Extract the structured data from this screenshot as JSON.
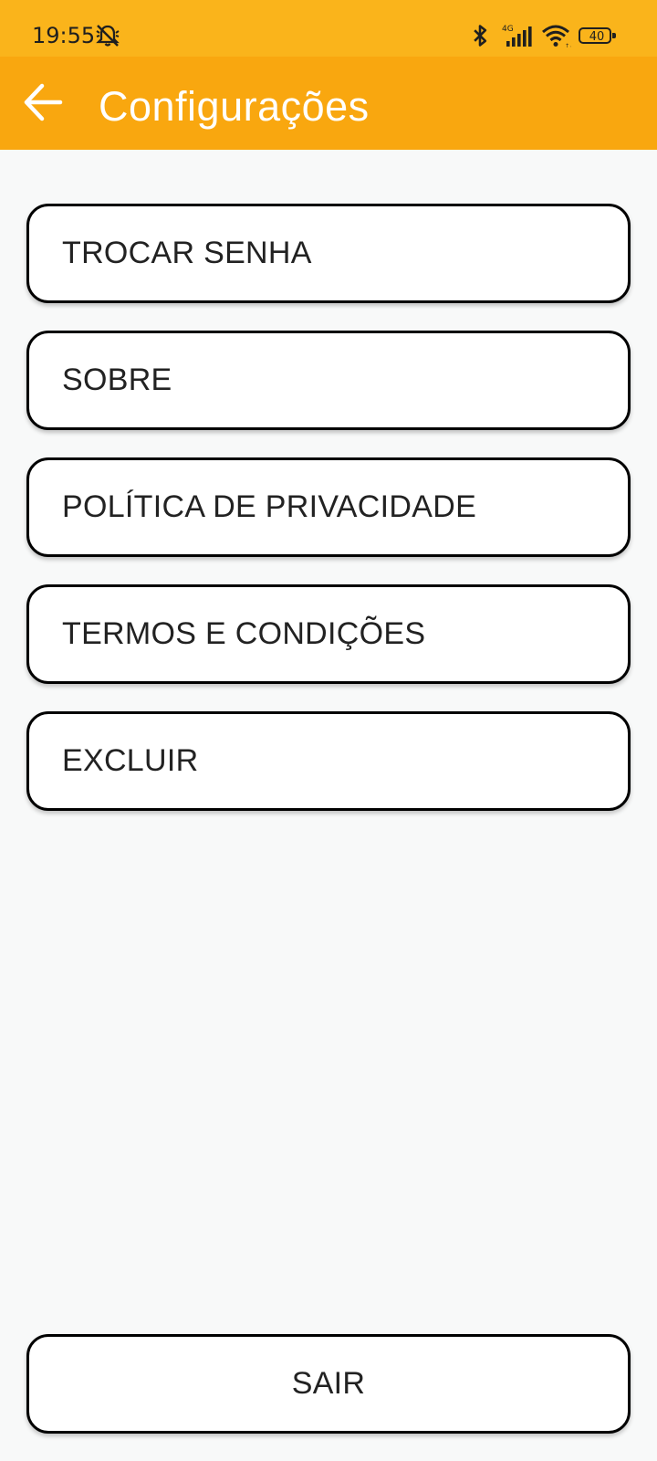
{
  "status_bar": {
    "time": "19:55",
    "left_icon": "notifications-off-icon",
    "network_label": "4G",
    "battery_level": "40",
    "icons": [
      "bluetooth-icon",
      "signal-icon",
      "wifi-icon",
      "battery-icon"
    ]
  },
  "app_bar": {
    "title": "Configurações",
    "back_icon": "back-arrow-icon"
  },
  "menu": {
    "items": [
      {
        "label": "TROCAR SENHA"
      },
      {
        "label": "SOBRE"
      },
      {
        "label": "POLÍTICA DE PRIVACIDADE"
      },
      {
        "label": "TERMOS E CONDIÇÕES"
      },
      {
        "label": "EXCLUIR"
      }
    ]
  },
  "footer": {
    "logout_label": "SAIR"
  },
  "colors": {
    "status_bar_bg": "#fab41b",
    "app_bar_bg": "#f9a70f",
    "page_bg": "#f8f9f9",
    "button_bg": "#ffffff",
    "button_border": "#000000",
    "text_dark": "#222222",
    "title_text": "#ffffff"
  }
}
